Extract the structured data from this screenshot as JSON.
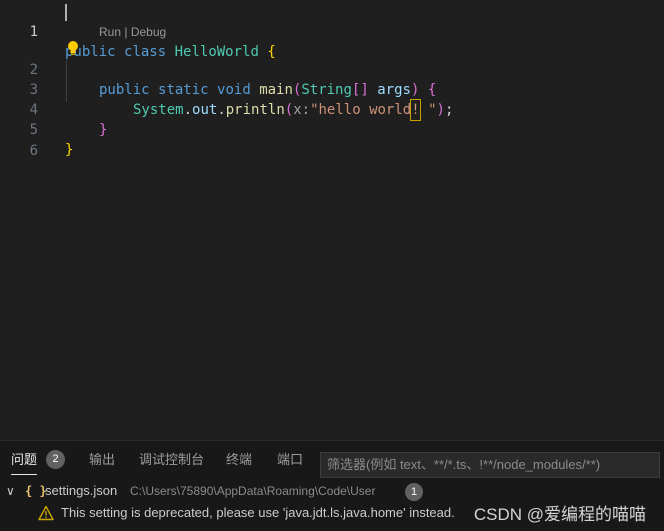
{
  "editor": {
    "line_numbers": [
      "1",
      "2",
      "3",
      "4",
      "5",
      "6"
    ],
    "line1": {
      "kw1": "public",
      "kw2": "class",
      "cls": "HelloWorld",
      "brace": "{"
    },
    "codelens": {
      "run": "Run",
      "sep": "|",
      "debug": "Debug"
    },
    "line2": {
      "kw1": "public",
      "kw2": "static",
      "kw3": "void",
      "fn": "main",
      "open": "(",
      "type": "String",
      "arr": "[]",
      "param": "args",
      "close": ")",
      "brace": "{"
    },
    "line3": {
      "obj": "System",
      "dot1": ".",
      "field": "out",
      "dot2": ".",
      "fn": "println",
      "open": "(",
      "hint": "x:",
      "str_a": "\"hello world",
      "str_mark": "!",
      "str_b": " \"",
      "close": ")",
      "semi": ";"
    },
    "line4": {
      "brace": "}"
    },
    "line5": {
      "brace": "}"
    }
  },
  "panel": {
    "tabs": [
      {
        "label": "问题",
        "count": "2"
      },
      {
        "label": "输出"
      },
      {
        "label": "调试控制台"
      },
      {
        "label": "终端"
      },
      {
        "label": "端口"
      }
    ],
    "filter_placeholder": "筛选器(例如 text、**/*.ts、!**/node_modules/**)",
    "file": {
      "name": "settings.json",
      "path": "C:\\Users\\75890\\AppData\\Roaming\\Code\\User",
      "count": "1"
    },
    "warning": "This setting is deprecated, please use 'java.jdt.ls.java.home' instead."
  },
  "watermark": "CSDN @爱编程的喵喵",
  "colors": {
    "keyword": "#569cd6",
    "class": "#4ec9b0",
    "function": "#dcdcaa",
    "string": "#ce9178",
    "warning": "#cca700"
  }
}
